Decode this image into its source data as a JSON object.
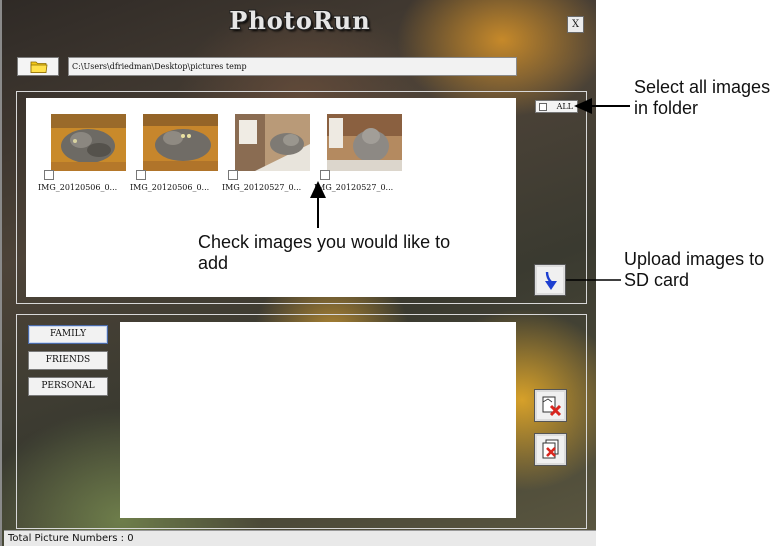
{
  "window": {
    "title": "PhotoRun",
    "close_label": "X"
  },
  "toolbar": {
    "folder_icon": "folder-icon",
    "path": "C:\\Users\\dfriedman\\Desktop\\pictures temp"
  },
  "images": [
    {
      "name": "IMG_20120506_0...",
      "checked": false
    },
    {
      "name": "IMG_20120506_0...",
      "checked": false
    },
    {
      "name": "IMG_20120527_0...",
      "checked": false
    },
    {
      "name": "IMG_20120527_0...",
      "checked": false
    }
  ],
  "select_all": {
    "label": "ALL",
    "checked": false
  },
  "upload_button": {
    "icon": "arrow-down-icon"
  },
  "albums": [
    {
      "label": "FAMILY",
      "selected": true
    },
    {
      "label": "FRIENDS",
      "selected": false
    },
    {
      "label": "PERSONAL",
      "selected": false
    }
  ],
  "delete_buttons": [
    {
      "icon": "delete-image-icon"
    },
    {
      "icon": "delete-all-images-icon"
    }
  ],
  "status": {
    "text": "Total Picture Numbers : 0"
  },
  "annotations": {
    "select_all": "Select all images in folder",
    "check_images": "Check images you would like to add",
    "upload": "Upload images to SD card"
  },
  "colors": {
    "delete_x": "#d8261e",
    "upload_arrow": "#1d3fd0",
    "folder": "#f2c818"
  }
}
